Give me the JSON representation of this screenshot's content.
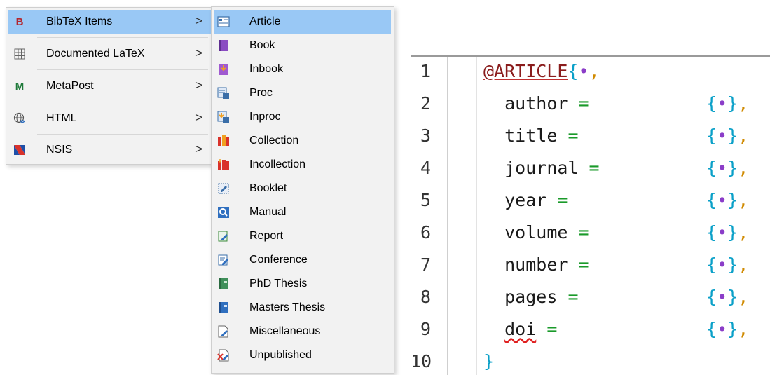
{
  "menu": {
    "items": [
      {
        "label": "BibTeX Items",
        "icon": "bibtex-b-icon",
        "active": true
      },
      {
        "label": "Documented LaTeX",
        "icon": "grid-icon"
      },
      {
        "label": "MetaPost",
        "icon": "metapost-m-icon"
      },
      {
        "label": "HTML",
        "icon": "globe-icon"
      },
      {
        "label": "NSIS",
        "icon": "nsis-icon"
      }
    ],
    "chevron": ">"
  },
  "submenu": {
    "items": [
      {
        "label": "Article",
        "icon": "article-icon",
        "active": true
      },
      {
        "label": "Book",
        "icon": "book-icon"
      },
      {
        "label": "Inbook",
        "icon": "inbook-icon"
      },
      {
        "label": "Proc",
        "icon": "proc-icon"
      },
      {
        "label": "Inproc",
        "icon": "inproc-icon"
      },
      {
        "label": "Collection",
        "icon": "collection-icon"
      },
      {
        "label": "Incollection",
        "icon": "incollection-icon"
      },
      {
        "label": "Booklet",
        "icon": "booklet-icon"
      },
      {
        "label": "Manual",
        "icon": "manual-icon"
      },
      {
        "label": "Report",
        "icon": "report-icon"
      },
      {
        "label": "Conference",
        "icon": "conference-icon"
      },
      {
        "label": "PhD Thesis",
        "icon": "phd-thesis-icon"
      },
      {
        "label": "Masters Thesis",
        "icon": "masters-thesis-icon"
      },
      {
        "label": "Miscellaneous",
        "icon": "miscellaneous-icon"
      },
      {
        "label": "Unpublished",
        "icon": "unpublished-icon"
      }
    ]
  },
  "editor": {
    "lines": [
      {
        "num": "1",
        "text": "@ARTICLE{•,"
      },
      {
        "num": "2",
        "field": "author",
        "value": "{•},"
      },
      {
        "num": "3",
        "field": "title",
        "value": "{•},"
      },
      {
        "num": "4",
        "field": "journal",
        "value": "{•},"
      },
      {
        "num": "5",
        "field": "year",
        "value": "{•},"
      },
      {
        "num": "6",
        "field": "volume",
        "value": "{•},"
      },
      {
        "num": "7",
        "field": "number",
        "value": "{•},"
      },
      {
        "num": "8",
        "field": "pages",
        "value": "{•},"
      },
      {
        "num": "9",
        "field": "doi",
        "value": "{•},"
      },
      {
        "num": "10",
        "text": "}"
      }
    ],
    "entry_type": "@ARTICLE",
    "placeholder": "•",
    "equals": "="
  },
  "colors": {
    "highlight": "#99c8f5",
    "menu_bg": "#f2f2f2",
    "brace": "#0aa0c8",
    "equals": "#1a9a2a",
    "placeholder_dot": "#8b3dc8"
  }
}
